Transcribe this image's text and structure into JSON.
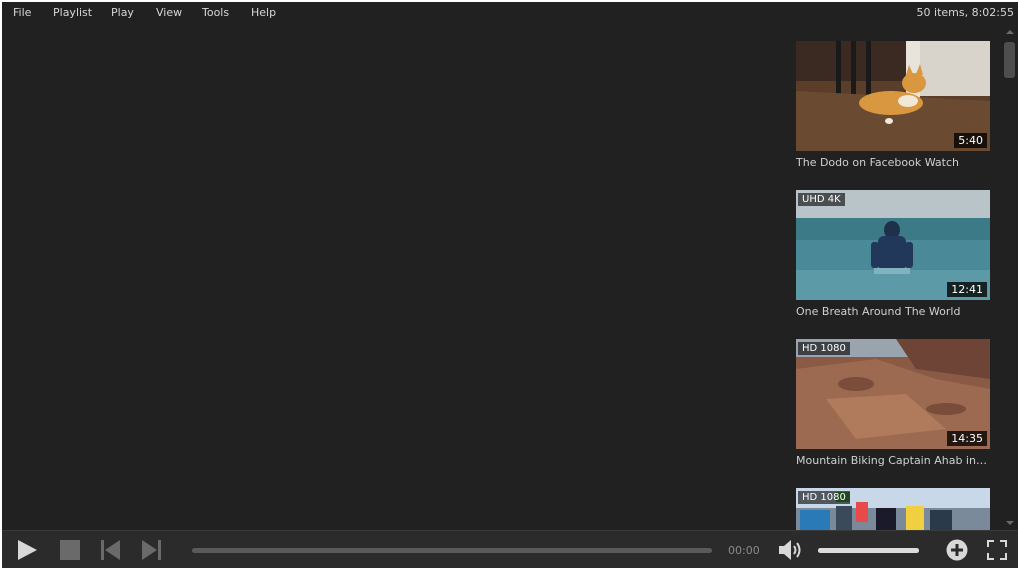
{
  "menu": {
    "items": [
      "File",
      "Playlist",
      "Play",
      "View",
      "Tools",
      "Help"
    ]
  },
  "status": {
    "summary": "50 items, 8:02:55"
  },
  "playlist": {
    "items": [
      {
        "title": "The Dodo on Facebook Watch",
        "duration": "5:40",
        "quality": ""
      },
      {
        "title": "One Breath Around The World",
        "duration": "12:41",
        "quality": "UHD 4K"
      },
      {
        "title": "Mountain Biking Captain Ahab in Moa...",
        "duration": "14:35",
        "quality": "HD 1080"
      },
      {
        "title": "",
        "duration": "",
        "quality": "HD 1080"
      }
    ]
  },
  "controls": {
    "time": "00:00",
    "seek_progress": 0,
    "volume_level": 1.0
  },
  "colors": {
    "background": "#212121",
    "controlbar": "#2b2b2b",
    "text": "#d6d6d6"
  },
  "icons": [
    "play-icon",
    "stop-icon",
    "previous-icon",
    "next-icon",
    "volume-icon",
    "add-icon",
    "fullscreen-icon",
    "scroll-up-icon",
    "scroll-down-icon"
  ]
}
